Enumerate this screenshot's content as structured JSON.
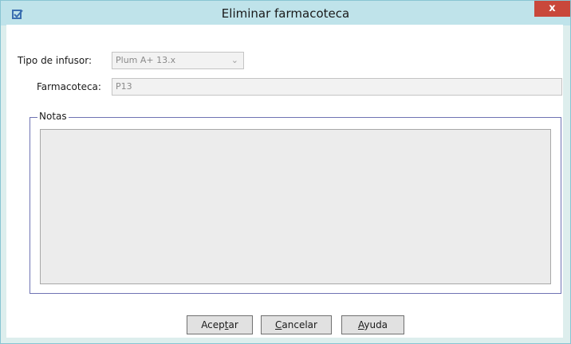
{
  "window": {
    "title": "Eliminar farmacoteca",
    "close_label": "x",
    "accent_color": "#bfe3ea",
    "close_color": "#c9483b"
  },
  "form": {
    "infuser_type_label": "Tipo de infusor:",
    "infuser_type_value": "Plum A+ 13.x",
    "library_label": "Farmacoteca:",
    "library_value": "P13"
  },
  "notes": {
    "legend": "Notas",
    "value": ""
  },
  "buttons": {
    "ok": {
      "pre": "Acep",
      "mn": "t",
      "post": "ar"
    },
    "cancel": {
      "pre": "",
      "mn": "C",
      "post": "ancelar"
    },
    "help": {
      "pre": "",
      "mn": "A",
      "post": "yuda"
    }
  }
}
